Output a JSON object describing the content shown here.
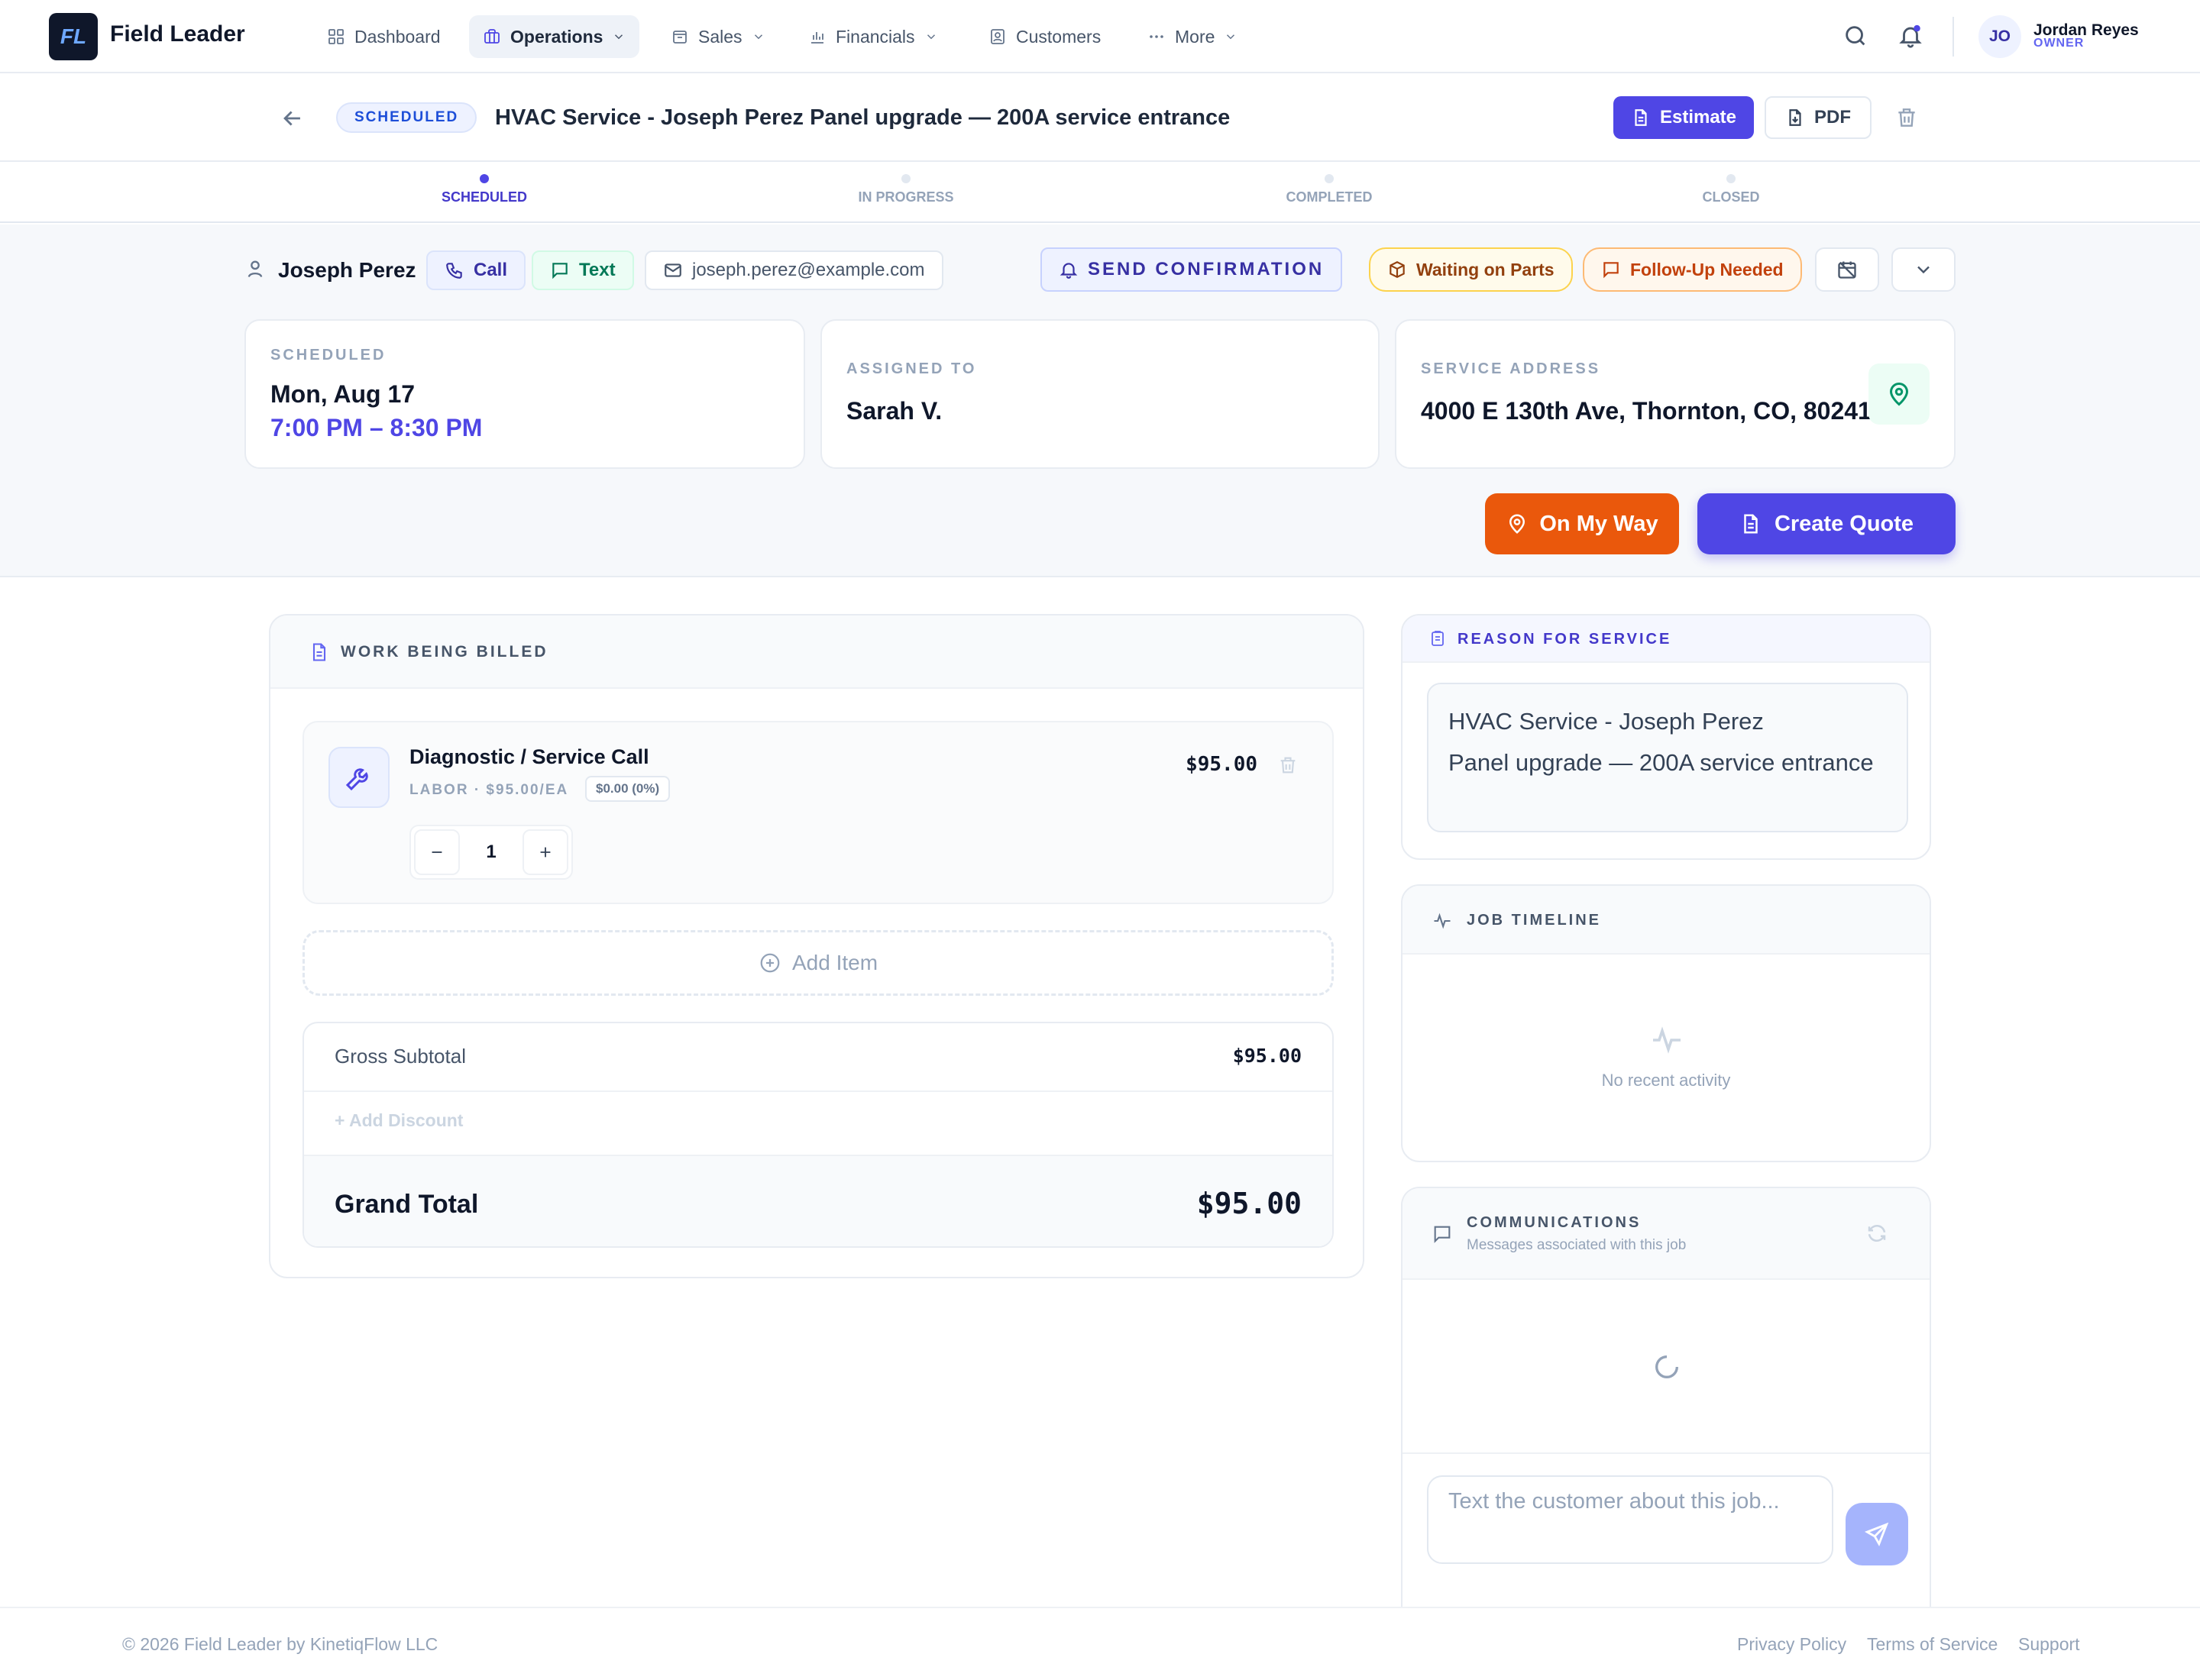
{
  "app": {
    "logo_text": "FL",
    "brand": "Field Leader"
  },
  "nav": {
    "items": [
      {
        "label": "Dashboard",
        "icon": "dashboard-icon"
      },
      {
        "label": "Operations",
        "icon": "briefcase-icon",
        "active": true
      },
      {
        "label": "Sales",
        "icon": "bag-icon"
      },
      {
        "label": "Financials",
        "icon": "bar-chart-icon"
      },
      {
        "label": "Customers",
        "icon": "contact-card-icon"
      },
      {
        "label": "More",
        "icon": "ellipsis-icon"
      }
    ],
    "user": {
      "initials": "JO",
      "name": "Jordan Reyes",
      "role": "OWNER"
    }
  },
  "job": {
    "status": "SCHEDULED",
    "title": "HVAC Service - Joseph Perez Panel upgrade — 200A service entrance",
    "estimate_label": "Estimate",
    "pdf_label": "PDF"
  },
  "stepper": [
    "SCHEDULED",
    "IN PROGRESS",
    "COMPLETED",
    "CLOSED"
  ],
  "customer": {
    "name": "Joseph Perez",
    "call_label": "Call",
    "text_label": "Text",
    "email": "joseph.perez@example.com",
    "send_confirmation": "SEND CONFIRMATION",
    "tag_waiting": "Waiting on Parts",
    "tag_follow": "Follow-Up Needed"
  },
  "cards": {
    "scheduled_label": "SCHEDULED",
    "scheduled_date": "Mon, Aug 17",
    "scheduled_time": "7:00 PM – 8:30 PM",
    "assigned_label": "ASSIGNED TO",
    "assigned_value": "Sarah V.",
    "address_label": "SERVICE ADDRESS",
    "address_value": "4000 E 130th Ave, Thornton, CO, 80241"
  },
  "actions": {
    "on_my_way": "On My Way",
    "create_quote": "Create Quote"
  },
  "billing": {
    "header": "WORK BEING BILLED",
    "item": {
      "name": "Diagnostic / Service Call",
      "meta": "LABOR · $95.00/EA",
      "discount_tag": "$0.00 (0%)",
      "price": "$95.00",
      "qty": "1"
    },
    "add_item": "Add Item",
    "gross_label": "Gross Subtotal",
    "gross_value": "$95.00",
    "add_discount": "Add Discount",
    "grand_label": "Grand Total",
    "grand_value": "$95.00"
  },
  "reason": {
    "header": "REASON FOR SERVICE",
    "line1": "HVAC Service - Joseph Perez",
    "line2": "Panel upgrade — 200A service entrance"
  },
  "timeline": {
    "header": "JOB TIMELINE",
    "empty": "No recent activity"
  },
  "comms": {
    "header": "COMMUNICATIONS",
    "subtitle": "Messages associated with this job",
    "placeholder": "Text the customer about this job..."
  },
  "footer": {
    "copyright": "© 2026 Field Leader by KinetiqFlow LLC",
    "links": [
      "Privacy Policy",
      "Terms of Service",
      "Support"
    ]
  },
  "colors": {
    "accent": "#4f46e5",
    "orange": "#ea580c",
    "brand_dark": "#0f172a"
  }
}
